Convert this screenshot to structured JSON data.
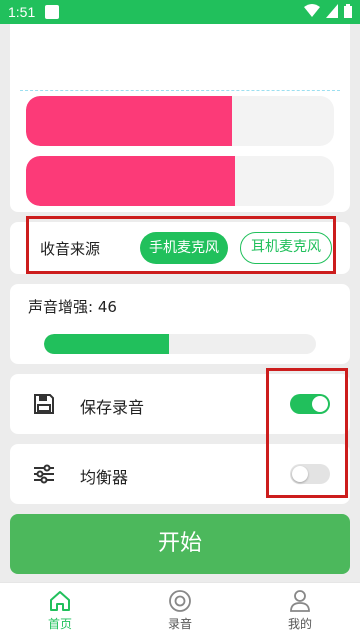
{
  "status_bar": {
    "time": "1:51"
  },
  "meters": {
    "level1": 0.67,
    "level2": 0.68
  },
  "audio_source": {
    "label": "收音来源",
    "options": [
      "手机麦克风",
      "耳机麦克风"
    ],
    "selected": "手机麦克风"
  },
  "boost": {
    "label": "声音增强: 46",
    "value": 46,
    "fill_fraction": 0.46
  },
  "settings": {
    "save_recording": {
      "label": "保存录音",
      "enabled": true
    },
    "equalizer": {
      "label": "均衡器",
      "enabled": false
    }
  },
  "start_button": {
    "label": "开始"
  },
  "nav": {
    "items": [
      {
        "label": "首页",
        "icon": "home-icon",
        "active": true
      },
      {
        "label": "录音",
        "icon": "record-icon",
        "active": false
      },
      {
        "label": "我的",
        "icon": "profile-icon",
        "active": false
      }
    ]
  },
  "colors": {
    "accent": "#21c05c",
    "meter": "#fc3a78",
    "start": "#4cb85c",
    "highlight_box": "#cc1d1d"
  }
}
